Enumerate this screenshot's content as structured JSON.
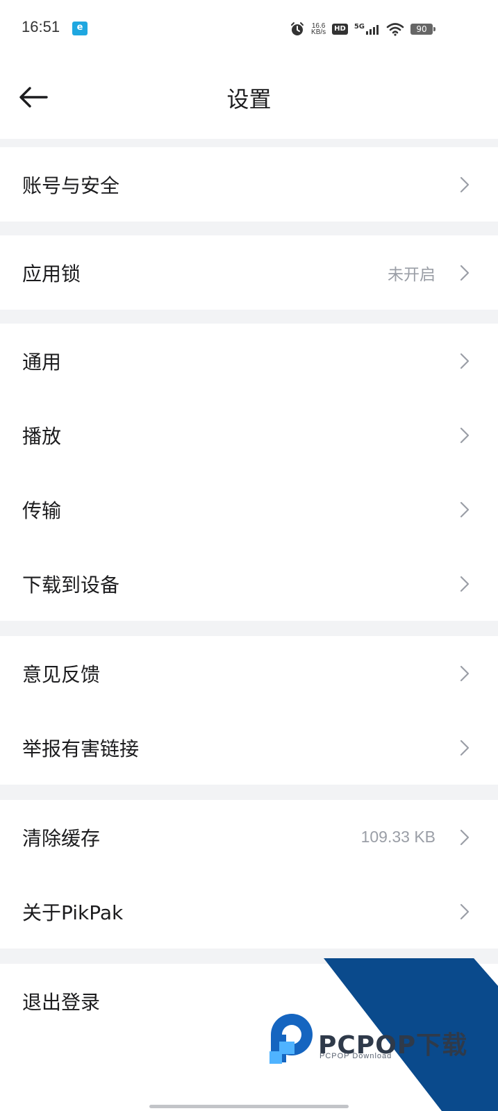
{
  "status_bar": {
    "time": "16:51",
    "speed_value": "16.6",
    "speed_unit": "KB/s",
    "hd": "HD",
    "network": "5G",
    "battery": "90"
  },
  "header": {
    "title": "设置"
  },
  "groups": [
    {
      "items": [
        {
          "label": "账号与安全",
          "value": ""
        }
      ]
    },
    {
      "items": [
        {
          "label": "应用锁",
          "value": "未开启"
        }
      ]
    },
    {
      "items": [
        {
          "label": "通用",
          "value": ""
        },
        {
          "label": "播放",
          "value": ""
        },
        {
          "label": "传输",
          "value": ""
        },
        {
          "label": "下载到设备",
          "value": ""
        }
      ]
    },
    {
      "items": [
        {
          "label": "意见反馈",
          "value": ""
        },
        {
          "label": "举报有害链接",
          "value": ""
        }
      ]
    },
    {
      "items": [
        {
          "label": "清除缓存",
          "value": "109.33 KB"
        },
        {
          "label": "关于PikPak",
          "value": ""
        }
      ]
    },
    {
      "items": [
        {
          "label": "退出登录",
          "value": ""
        }
      ]
    }
  ],
  "watermark": {
    "brand": "PCPOP下载",
    "sub": "PCPOP Download"
  },
  "colors": {
    "background": "#f2f3f5",
    "surface": "#ffffff",
    "secondary_text": "#9a9ea6",
    "watermark_blue": "#0a4a8c"
  }
}
